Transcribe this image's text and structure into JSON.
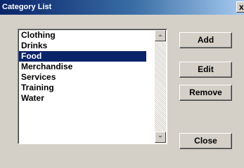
{
  "window": {
    "title": "Category List",
    "close_glyph": "x"
  },
  "list": {
    "items": [
      "Clothing",
      "Drinks",
      "Food",
      "Merchandise",
      "Services",
      "Training",
      "Water"
    ],
    "selected_index": 2
  },
  "buttons": {
    "add": "Add",
    "edit": "Edit",
    "remove": "Remove",
    "close": "Close"
  },
  "colors": {
    "selection": "#0a246a",
    "face": "#d4d0c8"
  }
}
